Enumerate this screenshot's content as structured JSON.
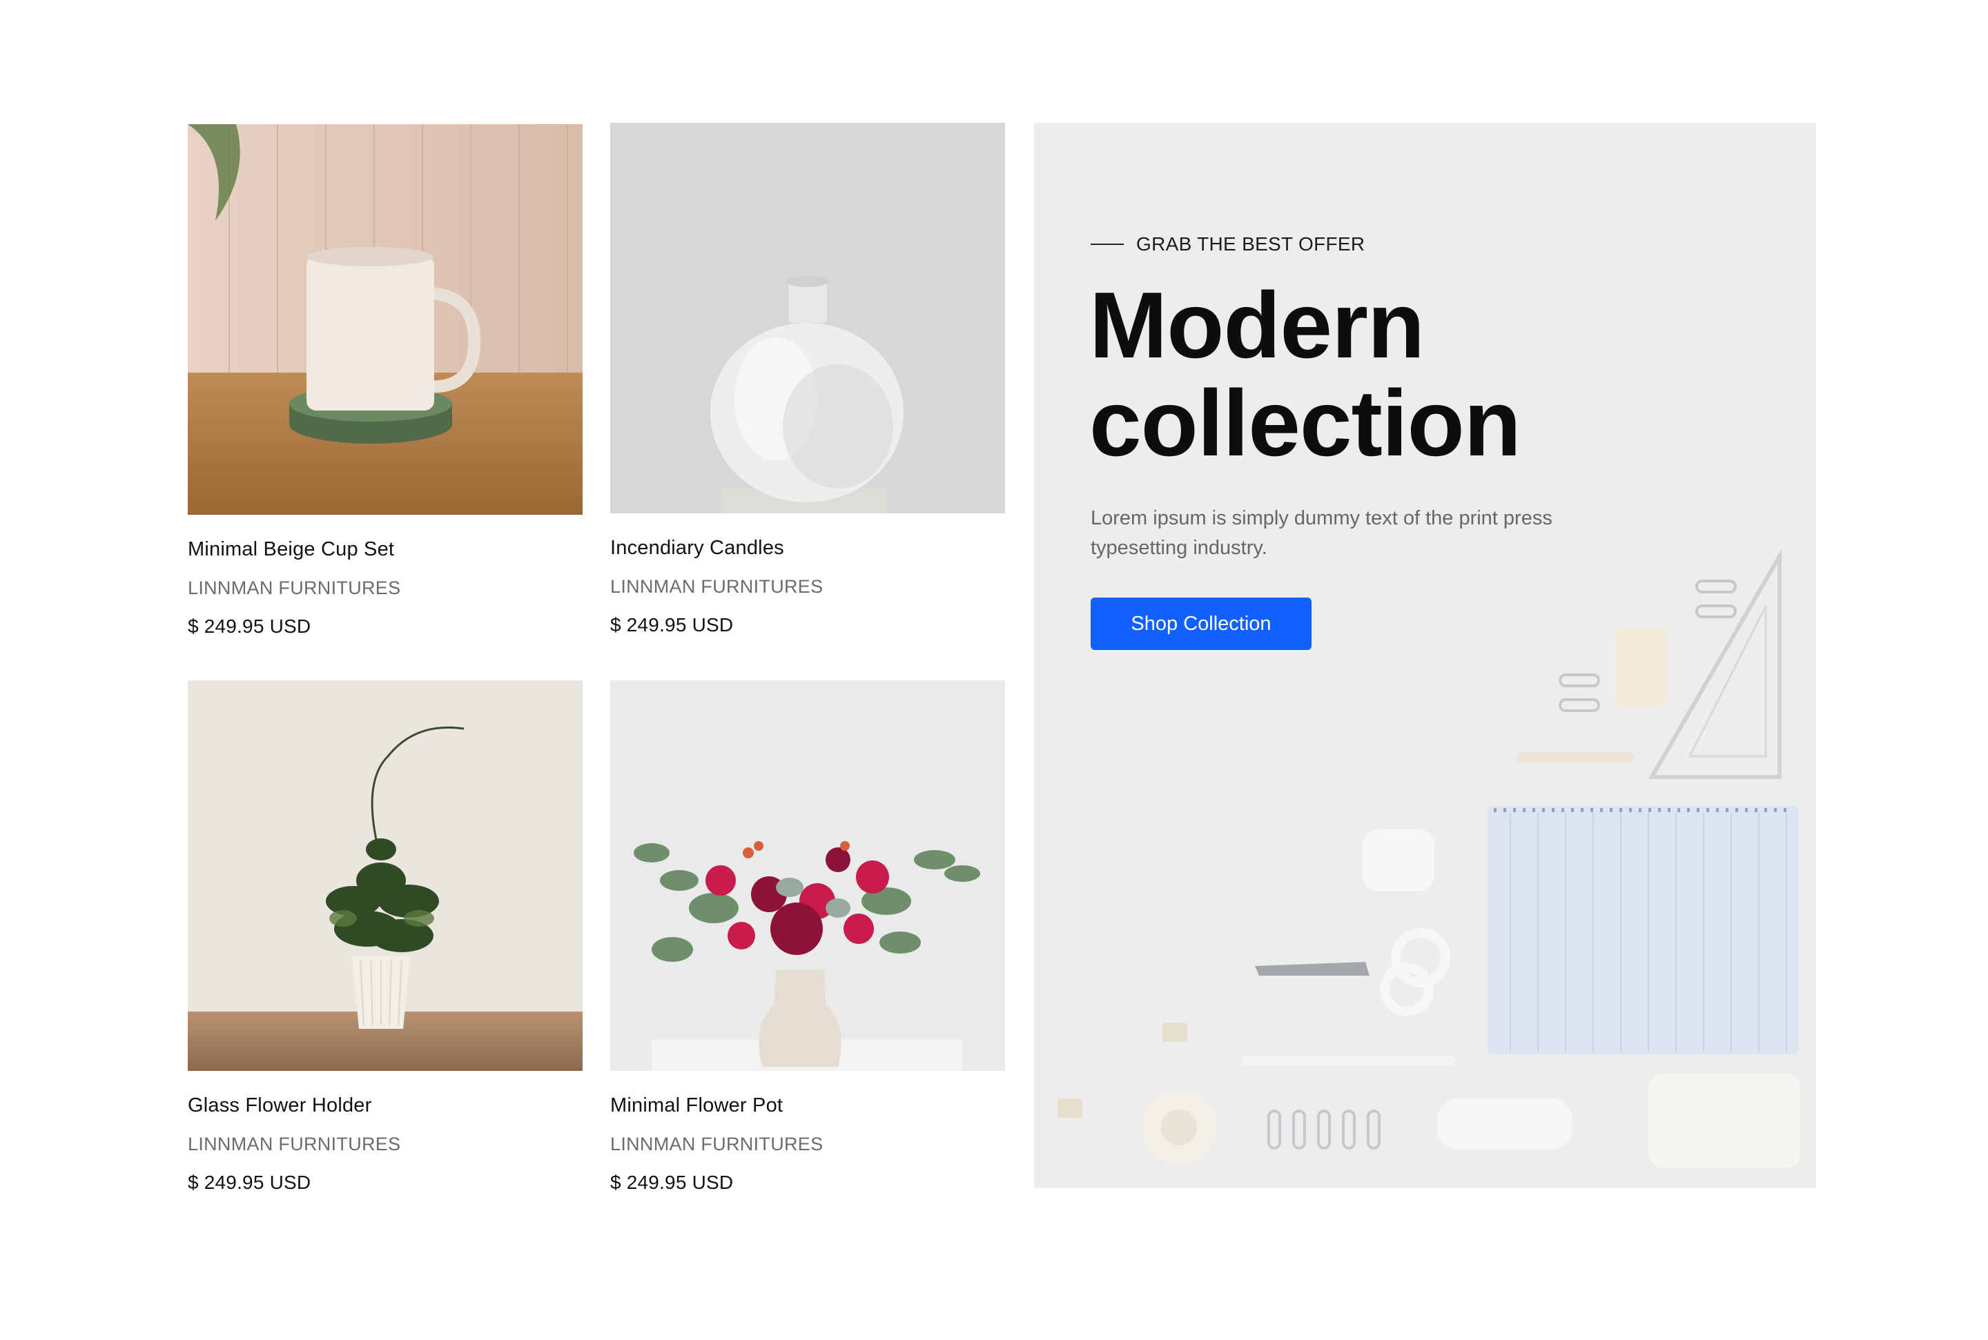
{
  "products": [
    {
      "title": "Minimal Beige Cup Set",
      "brand": "LINNMAN FURNITURES",
      "price": "$ 249.95 USD",
      "icon": "mug-photo"
    },
    {
      "title": "Incendiary Candles",
      "brand": "LINNMAN FURNITURES",
      "price": "$ 249.95 USD",
      "icon": "vase-photo"
    },
    {
      "title": "Glass Flower Holder",
      "brand": "LINNMAN FURNITURES",
      "price": "$ 249.95 USD",
      "icon": "plant-photo"
    },
    {
      "title": "Minimal Flower Pot",
      "brand": "LINNMAN FURNITURES",
      "price": "$ 249.95 USD",
      "icon": "bouquet-photo"
    }
  ],
  "banner": {
    "eyebrow": "GRAB THE BEST OFFER",
    "title_line1": "Modern",
    "title_line2": "collection",
    "description": "Lorem ipsum is simply dummy text of the print press typesetting industry.",
    "button_label": "Shop Collection",
    "background": "stationery-photo"
  },
  "colors": {
    "accent": "#1260ff",
    "heading": "#0d0d0f",
    "muted": "#6b6b6b",
    "banner_bg": "#ededec"
  }
}
